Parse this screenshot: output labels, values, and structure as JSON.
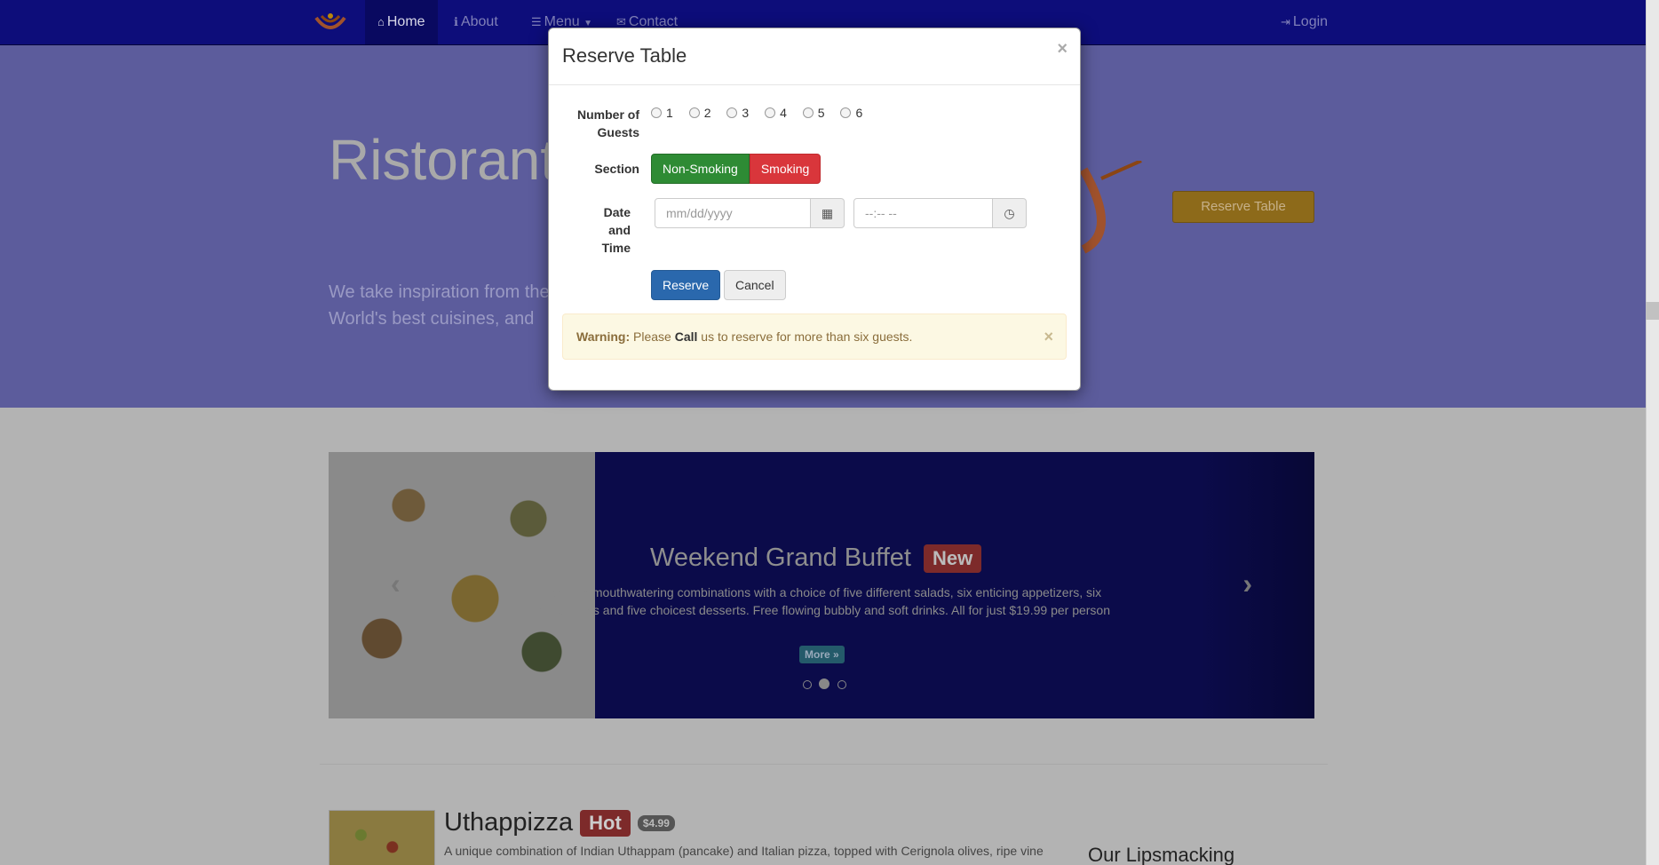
{
  "nav": {
    "items": [
      {
        "label": "Home",
        "icon": "home-icon"
      },
      {
        "label": "About",
        "icon": "info-icon"
      },
      {
        "label": "Menu",
        "icon": "list-icon"
      },
      {
        "label": "Contact",
        "icon": "envelope-icon"
      }
    ],
    "login": "Login"
  },
  "jumbotron": {
    "title": "Ristorante con Fusion",
    "text": "We take inspiration from the World's best cuisines, and create a unique fusion experience. Our lipsmacking creations",
    "button": "Reserve Table"
  },
  "carousel": {
    "title": "Weekend Grand Buffet",
    "badge": "New",
    "description": "Featuring mouthwatering combinations with a choice of five different salads, six enticing appetizers, six main entrees and five choicest desserts. Free flowing bubbly and soft drinks. All for just $19.99 per person",
    "more": "More »",
    "active_slide": 2,
    "slide_count": 3
  },
  "dish": {
    "name": "Uthappizza",
    "badge": "Hot",
    "price": "$4.99",
    "description": "A unique combination of Indian Uthappam (pancake) and Italian pizza, topped with Cerignola olives, ripe vine"
  },
  "side_heading": "Our Lipsmacking",
  "modal": {
    "title": "Reserve Table",
    "close": "×",
    "guests_label": "Number of Guests",
    "guest_options": [
      "1",
      "2",
      "3",
      "4",
      "5",
      "6"
    ],
    "section_label": "Section",
    "section_options": [
      "Non-Smoking",
      "Smoking"
    ],
    "datetime_label": "Date and Time",
    "date_placeholder": "mm/dd/yyyy",
    "time_placeholder": "--:-- --",
    "reserve": "Reserve",
    "cancel": "Cancel",
    "alert": {
      "strong": "Warning:",
      "before": " Please ",
      "call": "Call",
      "after": " us to reserve for more than six guests.",
      "close": "×"
    }
  },
  "colors": {
    "navbar": "#0d0d7a",
    "jumbotron": "#5c5c9c",
    "accent_button": "#8d6a1a",
    "success": "#2e8b34",
    "danger": "#d9363b",
    "primary": "#2a68ad",
    "warning_bg": "#fcf8e3"
  }
}
